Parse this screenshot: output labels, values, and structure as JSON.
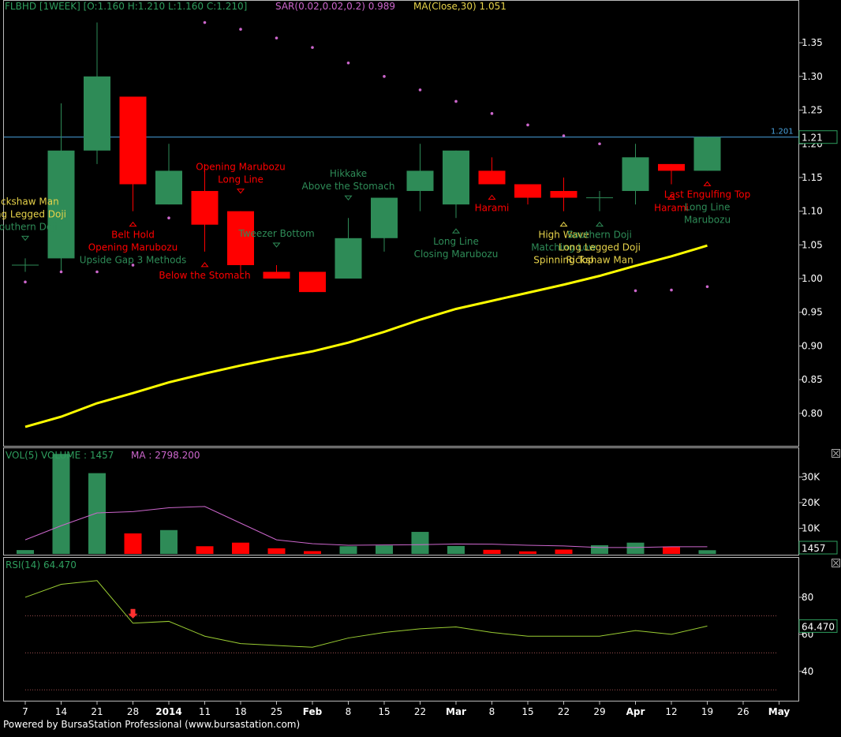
{
  "header": {
    "symbol": "FLBHD [1WEEK] [O:1.160 H:1.210 L:1.160 C:1.210]",
    "sar": "SAR(0.02,0.02,0.2)  0.989",
    "ma": "MA(Close,30)  1.051"
  },
  "footer": {
    "text": "Powered by BursaStation Professional (www.bursastation.com)"
  },
  "colors": {
    "bull": "#2e8b57",
    "bear": "#ff0000",
    "ma_line": "#ffff00",
    "sar": "#cc66cc",
    "grid": "#444444",
    "last_line": "#4aa3df"
  },
  "chart_data": [
    {
      "type": "candlestick",
      "panel": "price",
      "ylim": [
        0.76,
        1.39
      ],
      "y_ticks": [
        "0.80",
        "0.85",
        "0.90",
        "0.95",
        "1.00",
        "1.05",
        "1.10",
        "1.15",
        "1.20",
        "1.25",
        "1.30",
        "1.35"
      ],
      "x_labels": [
        "7",
        "14",
        "21",
        "28",
        "2014",
        "11",
        "18",
        "25",
        "Feb",
        "8",
        "15",
        "22",
        "Mar",
        "8",
        "15",
        "22",
        "29",
        "Apr",
        "12",
        "19",
        "26",
        "May"
      ],
      "last_value_label": "1.21",
      "hline_label": "1.201",
      "ohlc": [
        [
          1.02,
          1.03,
          1.01,
          1.02
        ],
        [
          1.03,
          1.26,
          1.01,
          1.19
        ],
        [
          1.19,
          1.38,
          1.17,
          1.3
        ],
        [
          1.27,
          1.27,
          1.1,
          1.14
        ],
        [
          1.11,
          1.2,
          1.11,
          1.16
        ],
        [
          1.13,
          1.17,
          1.04,
          1.08
        ],
        [
          1.1,
          1.1,
          1.0,
          1.02
        ],
        [
          1.01,
          1.02,
          1.0,
          1.0
        ],
        [
          1.01,
          1.01,
          0.98,
          0.98
        ],
        [
          1.0,
          1.09,
          1.0,
          1.06
        ],
        [
          1.06,
          1.12,
          1.04,
          1.12
        ],
        [
          1.13,
          1.2,
          1.1,
          1.16
        ],
        [
          1.11,
          1.19,
          1.09,
          1.19
        ],
        [
          1.16,
          1.18,
          1.14,
          1.14
        ],
        [
          1.14,
          1.14,
          1.11,
          1.12
        ],
        [
          1.13,
          1.15,
          1.1,
          1.12
        ],
        [
          1.12,
          1.13,
          1.1,
          1.12
        ],
        [
          1.13,
          1.2,
          1.11,
          1.18
        ],
        [
          1.17,
          1.17,
          1.14,
          1.16
        ],
        [
          1.16,
          1.21,
          1.16,
          1.21
        ]
      ],
      "sar_values": [
        0.995,
        1.01,
        1.01,
        1.02,
        1.09,
        1.38,
        1.37,
        1.357,
        1.343,
        1.32,
        1.3,
        1.28,
        1.263,
        1.245,
        1.228,
        1.212,
        1.2,
        0.982,
        0.983,
        0.988
      ],
      "ma_values": [
        0.78,
        0.795,
        0.815,
        0.83,
        0.846,
        0.859,
        0.871,
        0.882,
        0.892,
        0.905,
        0.921,
        0.939,
        0.955,
        0.967,
        0.979,
        0.991,
        1.004,
        1.019,
        1.033,
        1.049
      ],
      "annotations": [
        {
          "i": 0,
          "marker": "down",
          "color": "#2e8b57",
          "lines": [
            {
              "t": "Rickshaw Man",
              "c": "#e6d24a"
            },
            {
              "t": "Long Legged Doji",
              "c": "#e6d24a"
            },
            {
              "t": "Southern Doji",
              "c": "#2e8b57"
            }
          ]
        },
        {
          "i": 3,
          "marker": "up",
          "color": "#ff0000",
          "lines": [
            {
              "t": "Belt Hold",
              "c": "#ff0000"
            },
            {
              "t": "Opening Marubozu",
              "c": "#ff0000"
            },
            {
              "t": "Upside Gap 3 Methods",
              "c": "#2e8b57"
            }
          ]
        },
        {
          "i": 5,
          "marker": "up",
          "color": "#ff0000",
          "lines": [
            {
              "t": "Below the Stomach",
              "c": "#ff0000"
            }
          ]
        },
        {
          "i": 6,
          "marker": "down",
          "color": "#ff0000",
          "lines": [
            {
              "t": "Opening Marubozu",
              "c": "#ff0000"
            },
            {
              "t": "Long Line",
              "c": "#ff0000"
            }
          ]
        },
        {
          "i": 7,
          "marker": "down",
          "color": "#2e8b57",
          "lines": [
            {
              "t": "Tweezer Bottom",
              "c": "#2e8b57"
            }
          ]
        },
        {
          "i": 9,
          "marker": "down",
          "color": "#2e8b57",
          "lines": [
            {
              "t": "Hikkake",
              "c": "#2e8b57"
            },
            {
              "t": "Above the Stomach",
              "c": "#2e8b57"
            }
          ]
        },
        {
          "i": 12,
          "marker": "up",
          "color": "#2e8b57",
          "lines": [
            {
              "t": "Long Line",
              "c": "#2e8b57"
            },
            {
              "t": "Closing Marubozu",
              "c": "#2e8b57"
            }
          ]
        },
        {
          "i": 13,
          "marker": "up",
          "color": "#ff0000",
          "lines": [
            {
              "t": "Harami",
              "c": "#ff0000"
            }
          ]
        },
        {
          "i": 15,
          "marker": "up",
          "color": "#e6d24a",
          "lines": [
            {
              "t": "High Wave",
              "c": "#e6d24a"
            },
            {
              "t": "Matching Low",
              "c": "#2e8b57"
            },
            {
              "t": "Spinning Top",
              "c": "#e6d24a"
            }
          ]
        },
        {
          "i": 16,
          "marker": "up",
          "color": "#2e8b57",
          "lines": [
            {
              "t": "Southern Doji",
              "c": "#2e8b57"
            },
            {
              "t": "Long Legged Doji",
              "c": "#e6d24a"
            },
            {
              "t": "Rickshaw Man",
              "c": "#e6d24a"
            }
          ]
        },
        {
          "i": 18,
          "marker": "up",
          "color": "#ff0000",
          "lines": [
            {
              "t": "Harami",
              "c": "#ff0000"
            }
          ]
        },
        {
          "i": 19,
          "marker": "up",
          "color": "#ff0000",
          "lines": [
            {
              "t": "Last Engulfing Top",
              "c": "#ff0000"
            },
            {
              "t": "Long Line",
              "c": "#2e8b57"
            },
            {
              "t": "Marubozu",
              "c": "#2e8b57"
            }
          ]
        }
      ]
    },
    {
      "type": "bar",
      "panel": "volume",
      "title": "VOL(5)  VOLUME : 1457",
      "ma_label": "MA : 2798.200",
      "ylim": [
        0,
        40000
      ],
      "y_ticks": [
        {
          "v": 10000,
          "t": "10K"
        },
        {
          "v": 20000,
          "t": "20K"
        },
        {
          "v": 30000,
          "t": "30K"
        }
      ],
      "last_value_label": "1457",
      "values": [
        1500,
        39000,
        31500,
        8000,
        9300,
        3000,
        4400,
        2200,
        1100,
        3000,
        3300,
        8600,
        3100,
        1600,
        1000,
        1700,
        3400,
        4400,
        2900,
        1457
      ],
      "ma_values": [
        5500,
        11000,
        16000,
        16500,
        18000,
        18500,
        12000,
        5500,
        4000,
        3400,
        3500,
        3600,
        3900,
        3800,
        3400,
        3100,
        2500,
        2500,
        2800,
        2798
      ]
    },
    {
      "type": "line",
      "panel": "rsi",
      "title": "RSI(14)  64.470",
      "ylim": [
        25,
        100
      ],
      "y_ticks": [
        {
          "v": 40,
          "t": "40"
        },
        {
          "v": 60,
          "t": "60"
        },
        {
          "v": 80,
          "t": "80"
        }
      ],
      "ref_lines": [
        30,
        50,
        70
      ],
      "last_value_label": "64.470",
      "values": [
        80,
        87,
        89,
        66,
        67,
        59,
        55,
        54,
        53,
        58,
        61,
        63,
        64,
        61,
        59,
        59,
        59,
        62,
        60,
        64.47
      ]
    }
  ]
}
